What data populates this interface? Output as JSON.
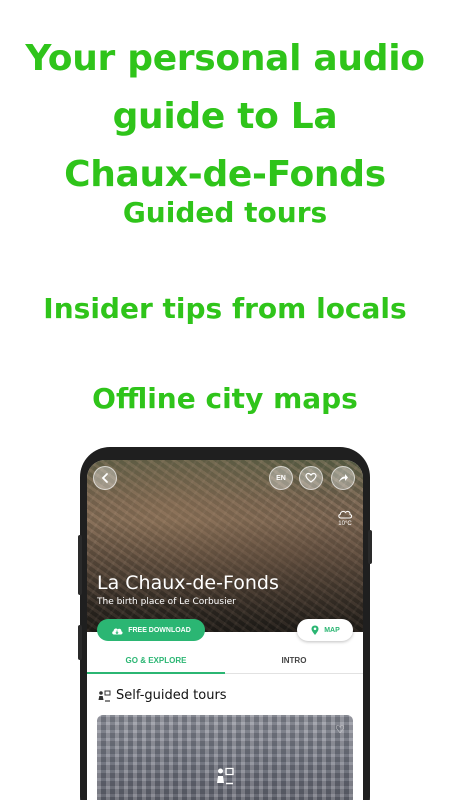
{
  "headline": [
    "Your personal audio",
    "guide to La",
    "Chaux-de-Fonds"
  ],
  "features": [
    "Guided tours",
    "Insider tips from locals",
    "Offline city maps"
  ],
  "colors": {
    "headline_green": "#2fc41a",
    "app_accent": "#2bb673"
  },
  "app": {
    "language_label": "EN",
    "weather_temp": "10°C",
    "city_title": "La Chaux-de-Fonds",
    "city_subtitle": "The birth place of Le Corbusier",
    "download_label": "FREE DOWNLOAD",
    "map_label": "MAP",
    "tabs": [
      "GO & EXPLORE",
      "INTRO"
    ],
    "section_title": "Self-guided tours"
  },
  "icons": [
    "back-arrow-icon",
    "heart-icon",
    "share-icon",
    "cloud-icon",
    "cloud-download-icon",
    "map-pin-icon",
    "tour-guide-icon"
  ]
}
